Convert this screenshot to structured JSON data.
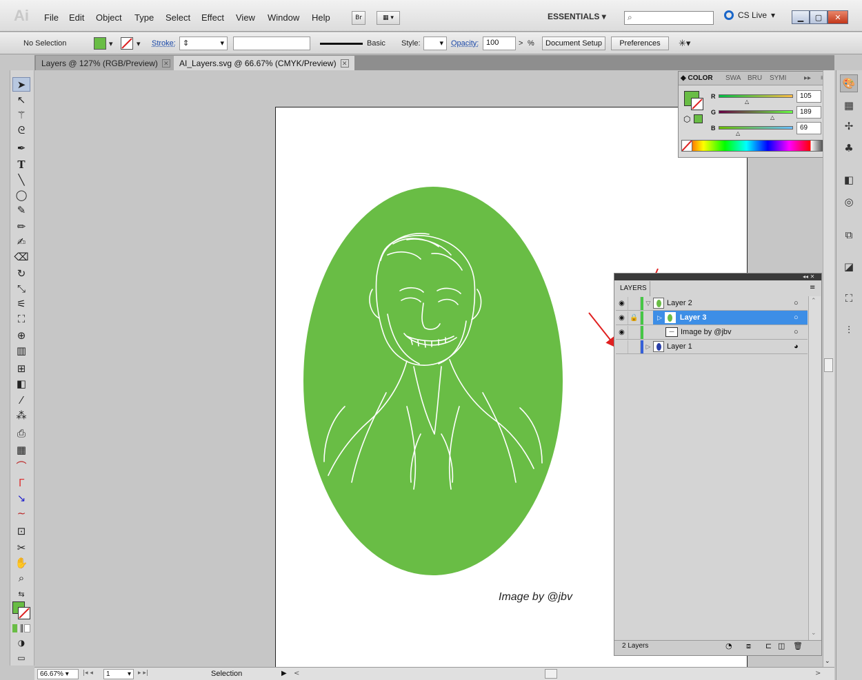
{
  "app": {
    "logo": "Ai"
  },
  "menu": [
    "File",
    "Edit",
    "Object",
    "Type",
    "Select",
    "Effect",
    "View",
    "Window",
    "Help"
  ],
  "menubar": {
    "bridge": "Br",
    "workspace": "ESSENTIALS",
    "cs_live": "CS Live"
  },
  "control": {
    "selection_label": "No Selection",
    "stroke_label": "Stroke:",
    "brush_label": "Basic",
    "style_label": "Style:",
    "opacity_label": "Opacity:",
    "opacity_value": "100",
    "opacity_unit": "%",
    "document_setup": "Document Setup",
    "preferences": "Preferences"
  },
  "tabs": [
    {
      "label": "Layers @ 127% (RGB/Preview)"
    },
    {
      "label": "AI_Layers.svg @ 66.67% (CMYK/Preview)"
    }
  ],
  "color_panel": {
    "tabs": [
      "COLOR",
      "SWA",
      "BRU",
      "SYMI"
    ],
    "r": "105",
    "g": "189",
    "b": "69",
    "r_label": "R",
    "g_label": "G",
    "b_label": "B",
    "fill_color": "#69bd45"
  },
  "artwork": {
    "caption": "Image by @jbv",
    "oval_color": "#69bd45"
  },
  "layers_panel": {
    "title": "LAYERS",
    "rows": [
      {
        "name": "Layer 2",
        "indent": 0,
        "color": "#46c646"
      },
      {
        "name": "Layer 3",
        "indent": 1,
        "color": "#46c646",
        "selected": true
      },
      {
        "name": "Image by @jbv",
        "indent": 2,
        "color": "#46c646"
      },
      {
        "name": "Layer 1",
        "indent": 0,
        "color": "#3560d8"
      }
    ],
    "footer": "2 Layers"
  },
  "status": {
    "zoom": "66.67%",
    "page": "1",
    "tool": "Selection"
  }
}
